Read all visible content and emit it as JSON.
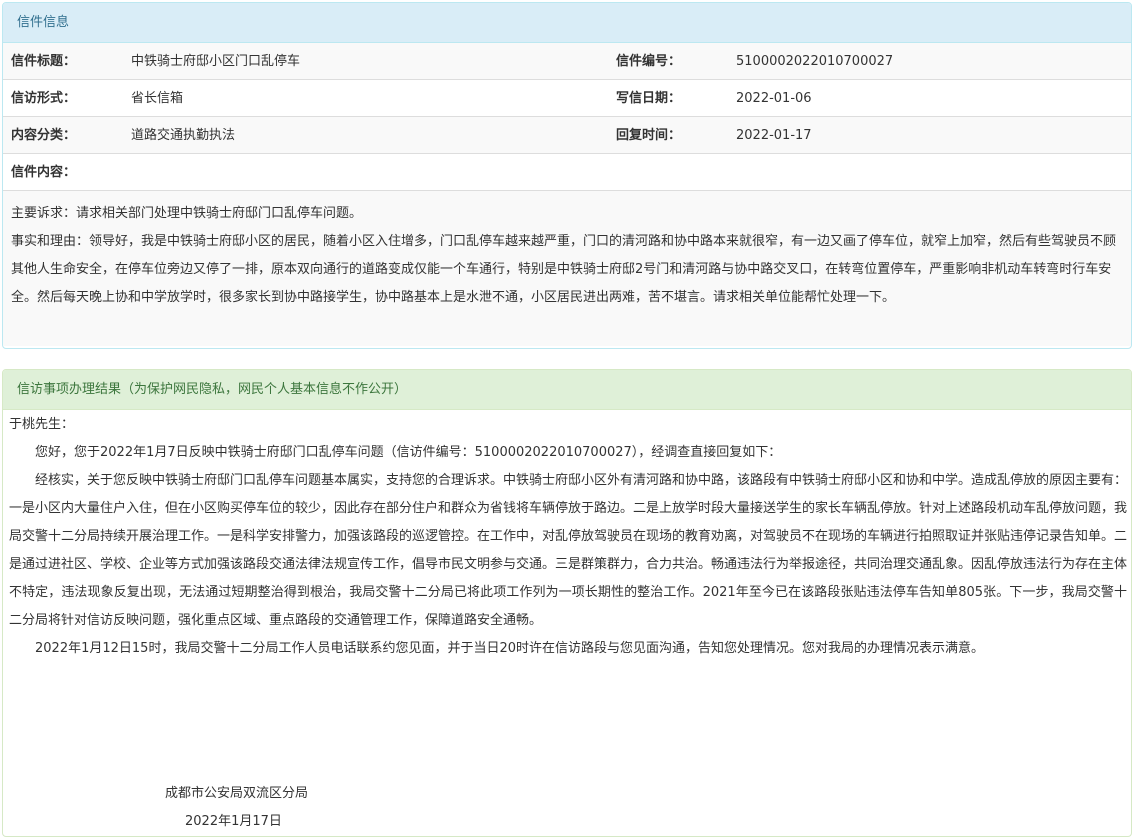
{
  "letter_info": {
    "heading": "信件信息",
    "rows": [
      {
        "label1": "信件标题：",
        "value1": "中铁骑士府邸小区门口乱停车",
        "label2": "信件编号：",
        "value2": "510000202201070002​7"
      },
      {
        "label1": "信访形式：",
        "value1": "省长信箱",
        "label2": "写信日期：",
        "value2": "2022-01-06"
      },
      {
        "label1": "内容分类：",
        "value1": "道路交通执勤执法",
        "label2": "回复时间：",
        "value2": "2022-01-17"
      }
    ],
    "content_label": "信件内容：",
    "content_lines": [
      "主要诉求：请求相关部门处理中铁骑士府邸门口乱停车问题。",
      "事实和理由：领导好，我是中铁骑士府邸小区的居民，随着小区入住增多，门口乱停车越来越严重，门口的清河路和协中路本来就很窄，有一边又画了停车位，就窄上加窄，然后有些驾驶员不顾其他人生命安全，在停车位旁边又停了一排，原本双向通行的道路变成仅能一个车通行，特别是中铁骑士府邸2号门和清河路与协中路交叉口，在转弯位置停车，严重影响非机动车转弯时行车安全。然后每天晚上协和中学放学时，很多家长到协中路接学生，协中路基本上是水泄不通，小区居民进出两难，苦不堪言。请求相关单位能帮忙处理一下。"
    ]
  },
  "result": {
    "heading": "信访事项办理结果（为保护网民隐私，网民个人基本信息不作公开）",
    "salutation": "于桃先生：",
    "paragraphs": [
      "您好，您于2022年1月7日反映中铁骑士府邸门口乱停车问题（信访件编号：5100002022010700027），经调查直接回复如下：",
      "经核实，关于您反映中铁骑士府邸门口乱停车问题基本属实，支持您的合理诉求。中铁骑士府邸小区外有清河路和协中路，该路段有中铁骑士府邸小区和协和中学。造成乱停放的原因主要有：一是小区内大量住户入住，但在小区购买停车位的较少，因此存在部分住户和群众为省钱将车辆停放于路边。二是上放学时段大量接送学生的家长车辆乱停放。针对上述路段机动车乱停放问题，我局交警十二分局持续开展治理工作。一是科学安排警力，加强该路段的巡逻管控。在工作中，对乱停放驾驶员在现场的教育劝离，对驾驶员不在现场的车辆进行拍照取证并张贴违停记录告知单。二是通过进社区、学校、企业等方式加强该路段交通法律法规宣传工作，倡导市民文明参与交通。三是群策群力，合力共治。畅通违法行为举报途径，共同治理交通乱象。因乱停放违法行为存在主体不特定，违法现象反复出现，无法通过短期整治得到根治，我局交警十二分局已将此项工作列为一项长期性的整治工作。2021年至今已在该路段张贴违法停车告知单805张。下一步，我局交警十二分局将针对信访反映问题，强化重点区域、重点路段的交通管理工作，保障道路安全通畅。",
      "2022年1月12日15时，我局交警十二分局工作人员电话联系约您见面，并于当日20时许在信访路段与您见面沟通，告知您处理情况。您对我局的办理情况表示满意。"
    ],
    "signature_org": "成都市公安局双流区分局",
    "signature_date": "2022年1月17日"
  }
}
